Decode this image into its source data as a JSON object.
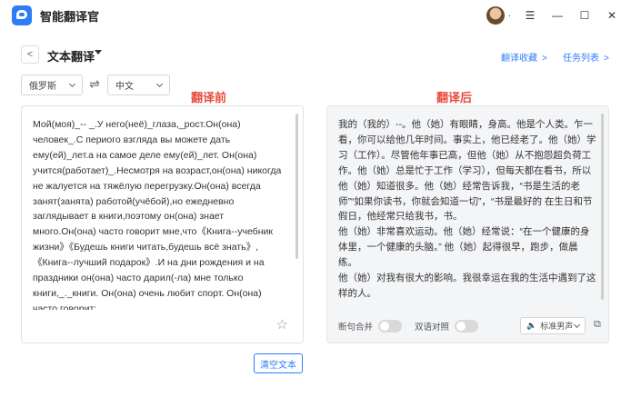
{
  "app": {
    "title": "智能翻译官"
  },
  "window_controls": {
    "menu": "☰",
    "minimize": "—",
    "maximize": "☐",
    "close": "✕",
    "avatar_dot": "·"
  },
  "header": {
    "back": "<",
    "title": "文本翻译",
    "link_favorites": "翻译收藏",
    "link_tasks": "任务列表",
    "chevron": ">"
  },
  "languages": {
    "source": "俄罗斯",
    "target": "中文",
    "swap": "⇌"
  },
  "labels": {
    "before": "翻译前",
    "after": "翻译后"
  },
  "source_text": "Мой(моя)_-- _.У него(неё)_глаза,_рост.Он(она) человек_.С периого взгляда вы можете дать ему(ей)_лет.а на самое деле ему(ей)_лет. Он(она) учится(работает)_.Несмотря на возраст,он(она) никогда не жалуется на тяжёлую перегрузку.Он(она) всегда занят(занята) работой(учёбой),но ежедневно заглядывает в книги,поэтому он(она) знает много.Он(она) часто говорит мне,что《Книга--учебник жизни》《Будешь книги читать,будешь всё знать》,《Книга--лучший подарок》.И на дни рождения и на праздники он(она) часто дарил(-ла) мне только книги,_._книги. Он(она) очень любит спорт. Он(она) часто говорит:",
  "target_text": "我的（我的）--。他（她）有眼睛，身高。他是个人类。乍一看，你可以给他几年时间。事实上，他已经老了。他（她）学习（工作）。尽管他年事已高，但他（她）从不抱怨超负荷工作。他（她）总是忙于工作（学习），但每天都在看书，所以他（她）知道很多。他（她）经常告诉我，“书是生活的老师”“如果你读书，你就会知道一切”，“书是最好的 在生日和节假日，他经常只给我书，书。\n他（她）非常喜欢运动。他（她）经常说：“在一个健康的身体里，一个健康的头脑。” 他（她）起得很早，跑步，做晨练。\n他（她）对我有很大的影响。我很幸运在我的生活中遇到了这样的人。",
  "options": {
    "sentence_merge": "断句合并",
    "bilingual": "双语对照",
    "voice": "标准男声",
    "speaker": "🔈"
  },
  "icons": {
    "star": "☆",
    "copy": "⧉"
  },
  "actions": {
    "clear": "清空文本"
  }
}
